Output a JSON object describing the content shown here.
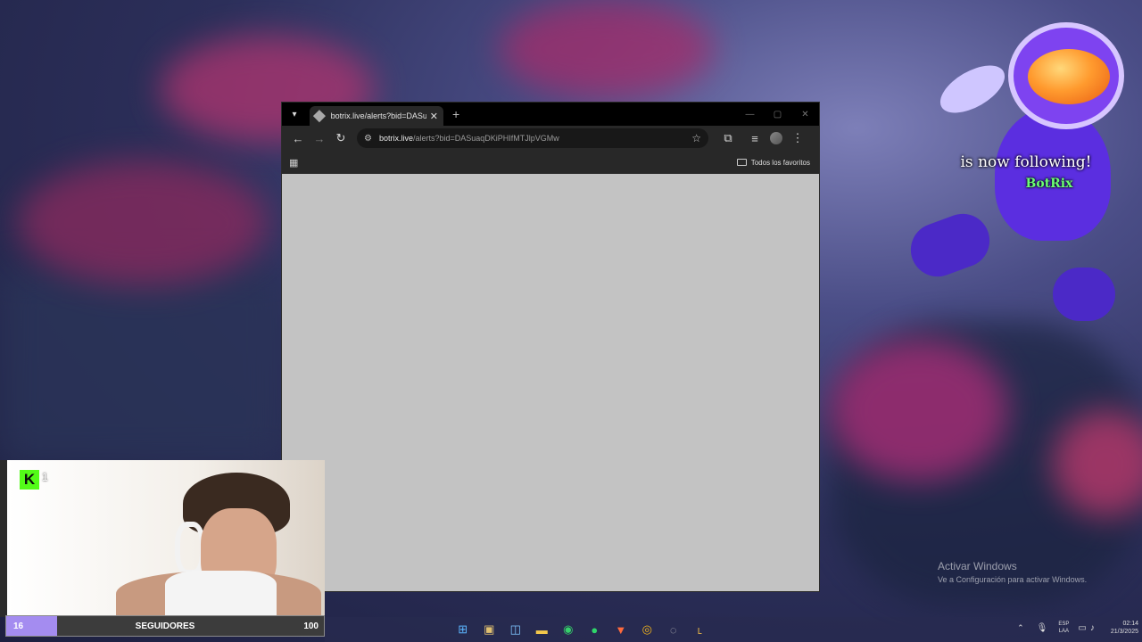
{
  "browser": {
    "tab_title": "botrix.live/alerts?bid=DASuaqD",
    "url_host": "botrix.live",
    "url_path": "/alerts?bid=DASuaqDKiPHIfMTJlpVGMw",
    "bookmark_folder": "Todos los favoritos"
  },
  "alert": {
    "text": "is now following!",
    "username": "BotRix"
  },
  "watermark": {
    "title": "Activar Windows",
    "subtitle": "Ve a Configuración para activar Windows."
  },
  "stream": {
    "kick_viewers": "1",
    "followers_current": "16",
    "followers_label": "SEGUIDORES",
    "followers_target": "100",
    "followers_progress": 0.16
  },
  "taskbar": {
    "lang_line1": "ESP",
    "lang_line2": "LAA",
    "time": "02:14",
    "date": "21/3/2025"
  },
  "colors": {
    "kick_green": "#53fc18",
    "goal_fill": "#a48cf0",
    "alert_name": "#6bff73"
  }
}
